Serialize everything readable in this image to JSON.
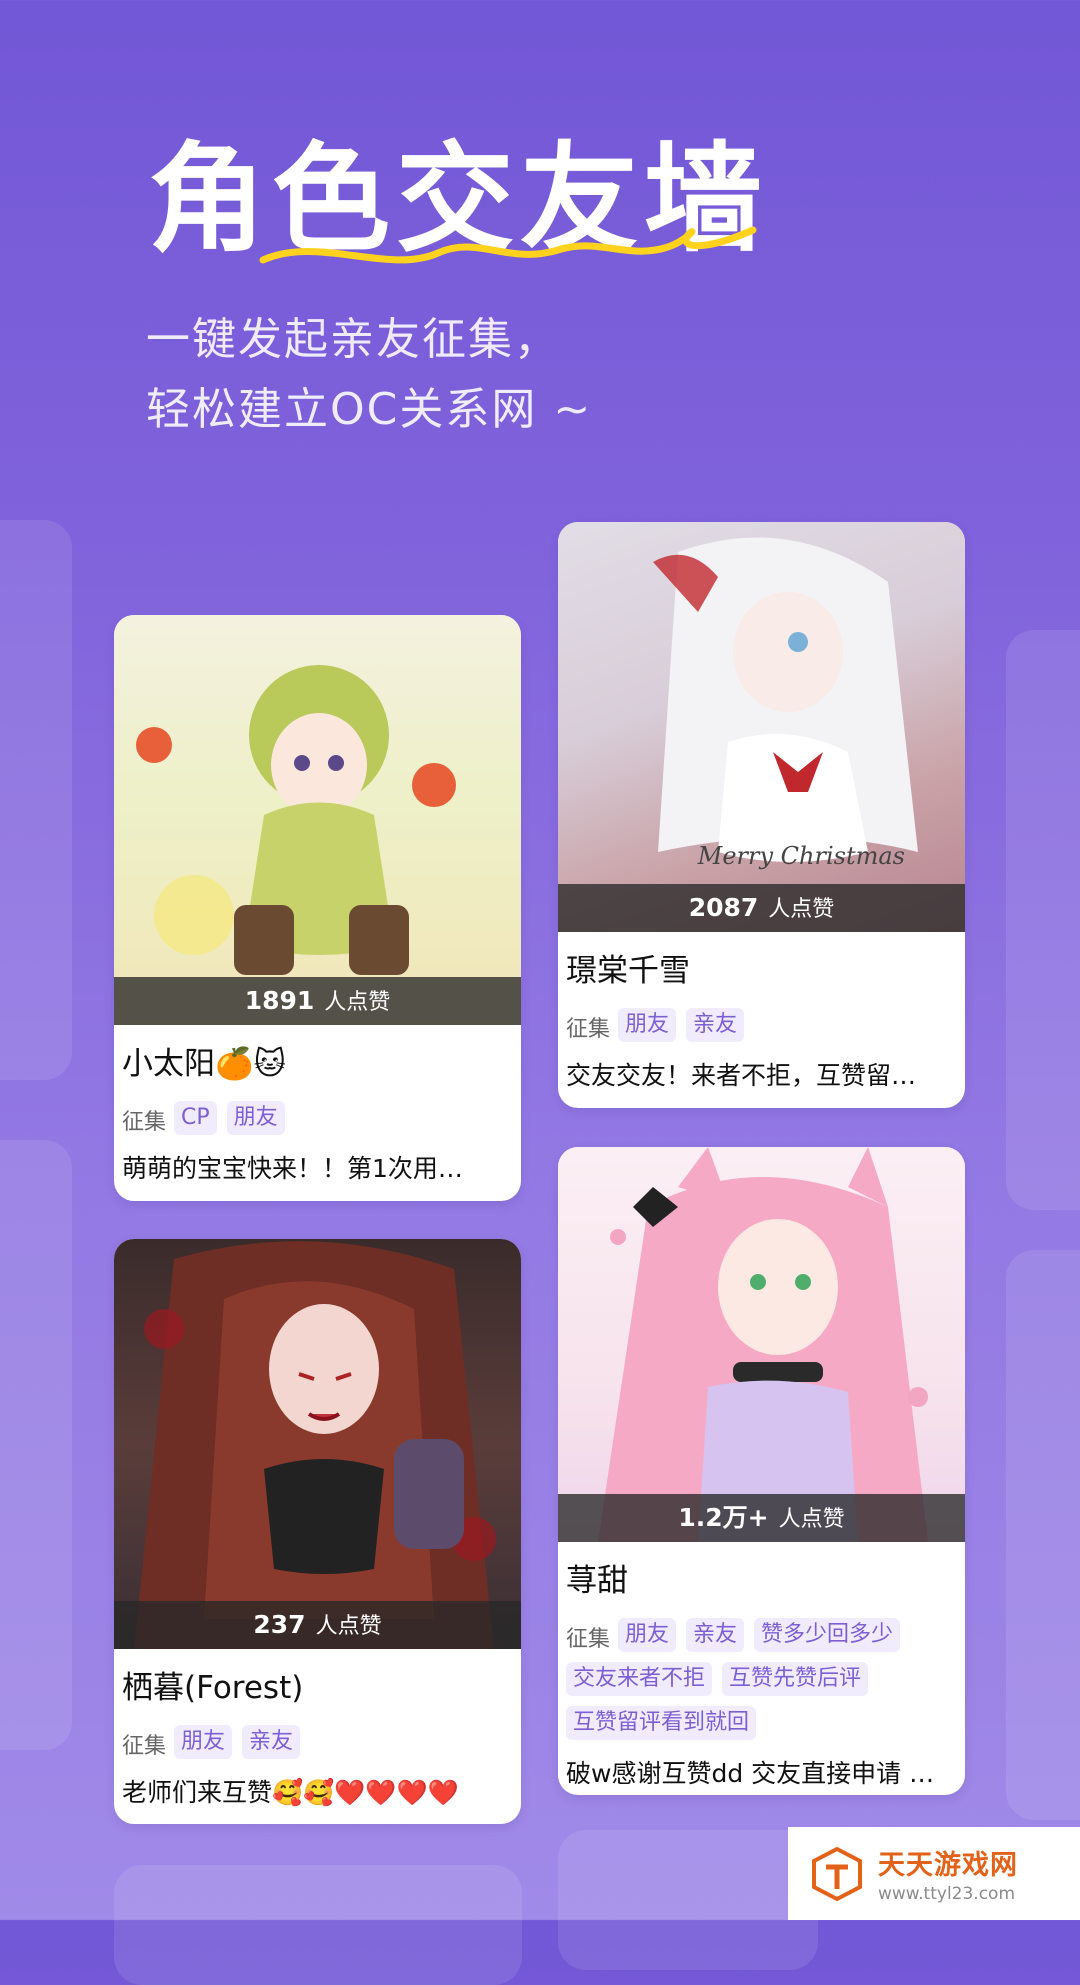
{
  "header": {
    "title": "角色交友墙",
    "subtitle_line1": "一键发起亲友征集，",
    "subtitle_line2": "轻松建立OC关系网 ~"
  },
  "likes_suffix": "人点赞",
  "tag_prefix": "征集",
  "cards": [
    {
      "likes": "1891",
      "name": "小太阳🍊🐱",
      "tags": [
        "CP",
        "朋友"
      ],
      "desc": "萌萌的宝宝快来！！第1次用…"
    },
    {
      "likes": "2087",
      "name": "璟棠千雪",
      "tags": [
        "朋友",
        "亲友"
      ],
      "desc": "交友交友！来者不拒，互赞留…",
      "art_caption": "Merry Christmas"
    },
    {
      "likes": "237",
      "name": "栖暮(Forest)",
      "tags": [
        "朋友",
        "亲友"
      ],
      "desc": "老师们来互赞🥰🥰❤️❤️❤️❤️"
    },
    {
      "likes": "1.2万+",
      "name": "荨甜",
      "tags": [
        "朋友",
        "亲友",
        "赞多少回多少",
        "交友来者不拒",
        "互赞先赞后评",
        "互赞留评看到就回"
      ],
      "desc": "破w感谢互赞dd 交友直接申请 …"
    }
  ],
  "watermark": {
    "main": "天天游戏网",
    "url": "www.ttyl23.com"
  },
  "colors": {
    "accent": "#7b5fd3",
    "tag_bg": "#f1ecfd",
    "underline": "#ffd21e",
    "watermark": "#e2621a"
  }
}
